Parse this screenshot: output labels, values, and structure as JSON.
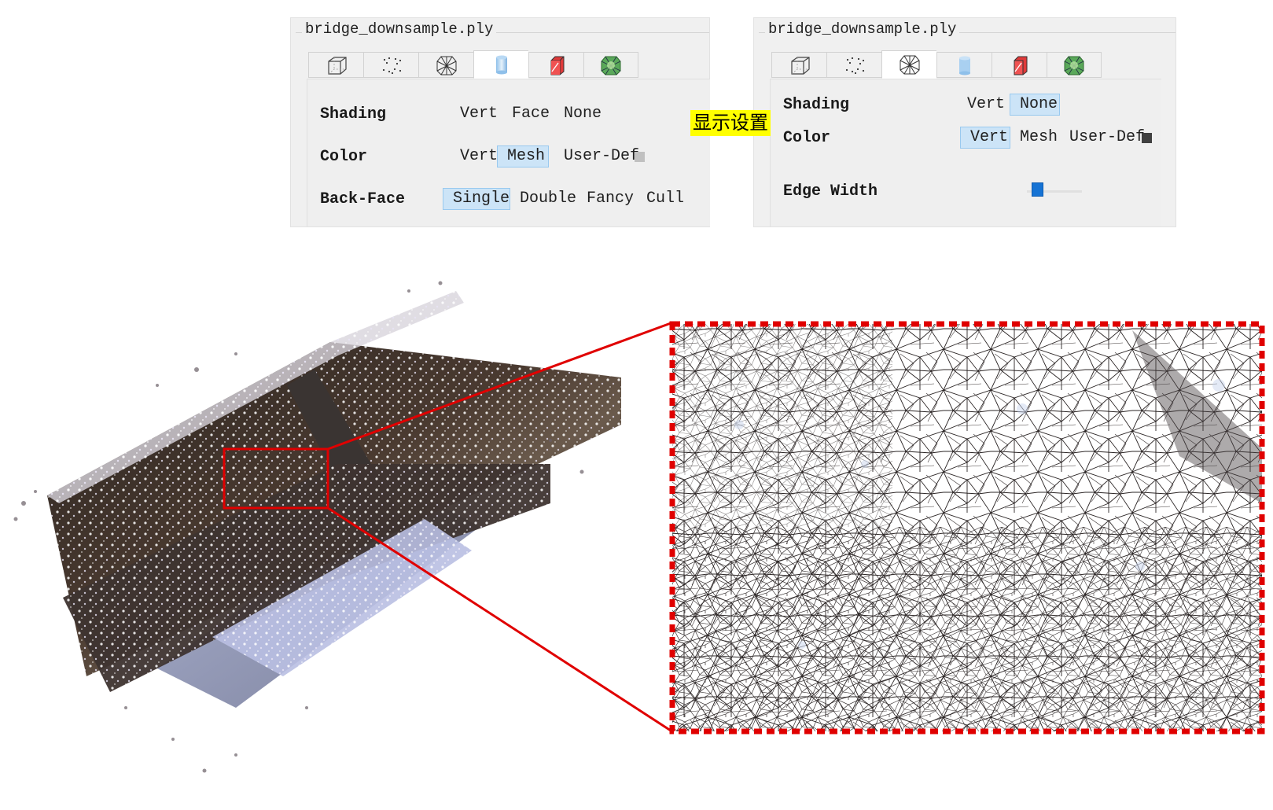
{
  "callout_label": "显示设置",
  "panels": {
    "left": {
      "file_name": "bridge_downsample.ply",
      "tabs": [
        {
          "icon": "cube-wireframe-icon",
          "active": false
        },
        {
          "icon": "point-cloud-icon",
          "active": false
        },
        {
          "icon": "mesh-wireframe-icon",
          "active": false
        },
        {
          "icon": "shaded-cylinder-icon",
          "active": true
        },
        {
          "icon": "red-prism-icon",
          "active": false
        },
        {
          "icon": "green-texture-icon",
          "active": false
        }
      ],
      "rows": [
        {
          "label": "Shading",
          "options": [
            "Vert",
            "Face",
            "None"
          ],
          "selected": null
        },
        {
          "label": "Color",
          "options": [
            "Vert",
            "Mesh",
            "User-Def"
          ],
          "selected": "Mesh",
          "swatch_color": "#c0c0c0"
        },
        {
          "label": "Back-Face",
          "options": [
            "Single",
            "Double",
            "Fancy",
            "Cull"
          ],
          "selected": "Single"
        }
      ]
    },
    "right": {
      "file_name": "bridge_downsample.ply",
      "tabs": [
        {
          "icon": "cube-wireframe-icon",
          "active": false
        },
        {
          "icon": "point-cloud-icon",
          "active": false
        },
        {
          "icon": "mesh-wireframe-icon",
          "active": true
        },
        {
          "icon": "shaded-cylinder-icon",
          "active": false
        },
        {
          "icon": "red-prism-icon",
          "active": false
        },
        {
          "icon": "green-texture-icon",
          "active": false
        }
      ],
      "rows": [
        {
          "label": "Shading",
          "options": [
            "Vert",
            "None"
          ],
          "selected": "None"
        },
        {
          "label": "Color",
          "options": [
            "Vert",
            "Mesh",
            "User-Def"
          ],
          "selected": "Vert",
          "swatch_color": "#404040"
        },
        {
          "label": "Edge Width",
          "slider_value": 0.1
        }
      ]
    }
  },
  "colors": {
    "selection_bg": "#cce4f7",
    "zoom_frame": "#e00000",
    "slider_thumb": "#1673d4",
    "callout_bg": "#ffff00"
  }
}
